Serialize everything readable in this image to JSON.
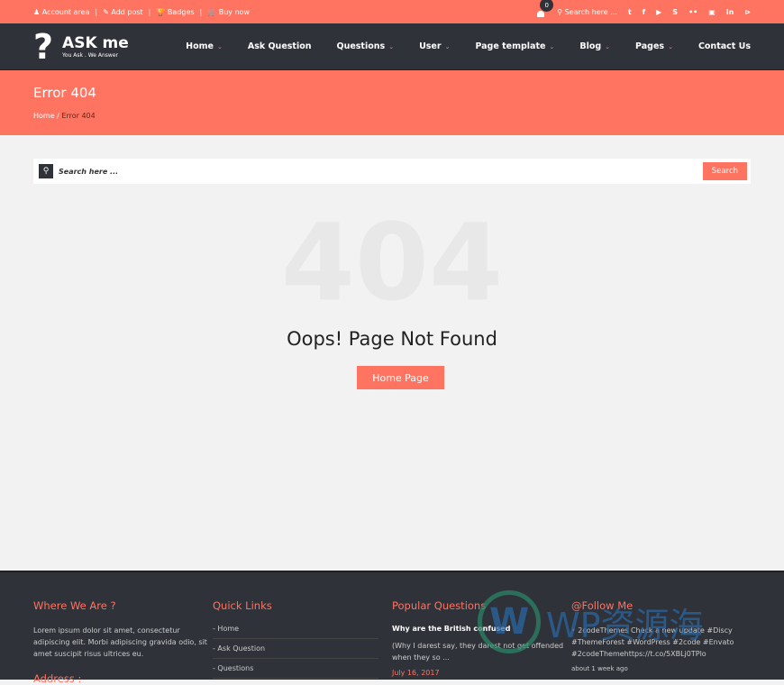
{
  "topbar": {
    "links": [
      "Account area",
      "Add post",
      "Badges",
      "Buy now"
    ],
    "notifications": "0",
    "search_placeholder": "Search here ...",
    "social": [
      "twitter",
      "facebook",
      "youtube",
      "skype",
      "flickr",
      "dribbble",
      "linkedin",
      "rss"
    ]
  },
  "brand": {
    "name": "ASK me",
    "tagline": "You Ask . We Answer"
  },
  "nav": [
    {
      "label": "Home",
      "dropdown": true
    },
    {
      "label": "Ask Question",
      "dropdown": false
    },
    {
      "label": "Questions",
      "dropdown": true
    },
    {
      "label": "User",
      "dropdown": true
    },
    {
      "label": "Page template",
      "dropdown": true
    },
    {
      "label": "Blog",
      "dropdown": true
    },
    {
      "label": "Pages",
      "dropdown": true
    },
    {
      "label": "Contact Us",
      "dropdown": false
    }
  ],
  "hero": {
    "title": "Error 404",
    "breadcrumb": [
      "Home",
      "Error 404"
    ]
  },
  "search": {
    "placeholder": "Search here ...",
    "button": "Search"
  },
  "error": {
    "code": "404",
    "message": "Oops! Page Not Found",
    "button": "Home Page"
  },
  "footer": {
    "where": {
      "title": "Where We Are ?",
      "text": "Lorem ipsum dolor sit amet, consectetur adipiscing elit. Morbi adipiscing gravida odio, sit amet suscipit risus ultrices eu.",
      "address": "Address :"
    },
    "links": {
      "title": "Quick Links",
      "items": [
        "- Home",
        "- Ask Question",
        "- Questions"
      ]
    },
    "popular": {
      "title": "Popular Questions",
      "question": "Why are the British confused",
      "excerpt": "(Why I darest say, they darest not get offended when they so ...",
      "date": "July 16, 2017"
    },
    "follow": {
      "title": "@Follow Me",
      "tweet": "2codeThemes Check a new update #Discy #ThemeForest #WordPress #2code #Envato #2codeThemehttps://t.co/5XBLj0TPlo",
      "ago": "about 1 week ago"
    }
  },
  "watermark": "WP资源海",
  "colors": {
    "accent": "#ff7361",
    "dark": "#2f3239",
    "background": "#f2f2f2"
  }
}
